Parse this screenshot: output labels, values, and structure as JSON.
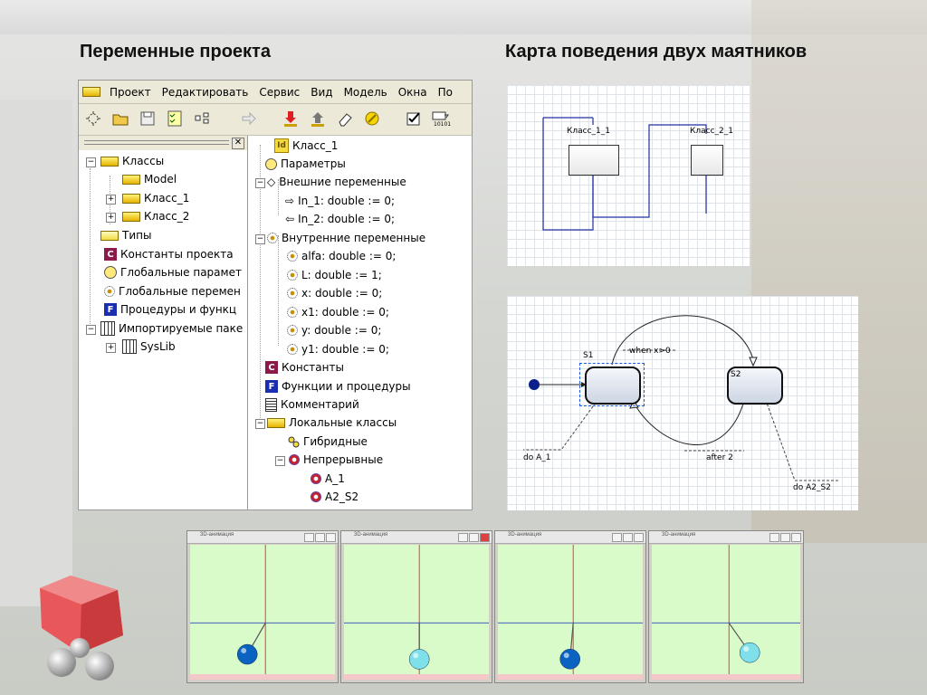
{
  "headings": {
    "left": "Переменные проекта",
    "right": "Карта поведения двух маятников"
  },
  "menu": [
    "Проект",
    "Редактировать",
    "Сервис",
    "Вид",
    "Модель",
    "Окна",
    "По"
  ],
  "left_tree": [
    {
      "label": "Классы",
      "icon": "folder-icon"
    },
    {
      "label": "Model",
      "icon": "folder-icon"
    },
    {
      "label": "Класс_1",
      "icon": "folder-icon"
    },
    {
      "label": "Класс_2",
      "icon": "folder-icon"
    },
    {
      "label": "Типы",
      "icon": "folder-icon"
    },
    {
      "label": "Константы проекта",
      "icon": "constant-icon"
    },
    {
      "label": "Глобальные парамет",
      "icon": "parameter-icon"
    },
    {
      "label": "Глобальные перемен",
      "icon": "variable-icon"
    },
    {
      "label": "Процедуры и функц",
      "icon": "function-icon"
    },
    {
      "label": "Импортируемые паке",
      "icon": "package-icon"
    },
    {
      "label": "SysLib",
      "icon": "package-icon"
    }
  ],
  "right_tree": [
    {
      "label": "Класс_1",
      "icon": "id-icon"
    },
    {
      "label": "Параметры",
      "icon": "parameter-icon"
    },
    {
      "label": "Внешние переменные",
      "icon": "external-vars-icon"
    },
    {
      "label": "In_1: double := 0;",
      "icon": "input-arrow-icon"
    },
    {
      "label": "In_2: double := 0;",
      "icon": "output-arrow-icon"
    },
    {
      "label": "Внутренние переменные",
      "icon": "variable-icon"
    },
    {
      "label": "alfa: double := 0;",
      "icon": "variable-icon"
    },
    {
      "label": "L: double := 1;",
      "icon": "variable-icon"
    },
    {
      "label": "x: double := 0;",
      "icon": "variable-icon"
    },
    {
      "label": "x1: double := 0;",
      "icon": "variable-icon"
    },
    {
      "label": "y: double := 0;",
      "icon": "variable-icon"
    },
    {
      "label": "y1: double := 0;",
      "icon": "variable-icon"
    },
    {
      "label": "Константы",
      "icon": "constant-icon"
    },
    {
      "label": "Функции и процедуры",
      "icon": "function-icon"
    },
    {
      "label": "Комментарий",
      "icon": "comment-icon"
    },
    {
      "label": "Локальные классы",
      "icon": "folder-icon"
    },
    {
      "label": "Гибридные",
      "icon": "hybrid-icon"
    },
    {
      "label": "Непрерывные",
      "icon": "continuous-icon"
    },
    {
      "label": "A_1",
      "icon": "continuous-icon"
    },
    {
      "label": "A2_S2",
      "icon": "continuous-icon"
    }
  ],
  "structure_diagram": {
    "class1": "Класс_1_1",
    "class2": "Класс_2_1"
  },
  "state_diagram": {
    "s1": "S1",
    "s2": "S2",
    "transition1": "when x>0",
    "transition2": "after 2",
    "do1": "do A_1",
    "do2": "do A2_S2"
  },
  "animation_windows": [
    {
      "title": "3D-анимация",
      "pendulum_angle_deg": 30
    },
    {
      "title": "3D-анимация",
      "pendulum_angle_deg": 0
    },
    {
      "title": "3D-анимация",
      "pendulum_angle_deg": 5
    },
    {
      "title": "3D-анимация",
      "pendulum_angle_deg": -35
    }
  ],
  "colors": {
    "pendulum_ball_blue": "#0a63c0",
    "pendulum_ball_cyan": "#7fe0ea",
    "animation_background": "#d9fbc9",
    "state_marker": "#0a1e8c"
  }
}
